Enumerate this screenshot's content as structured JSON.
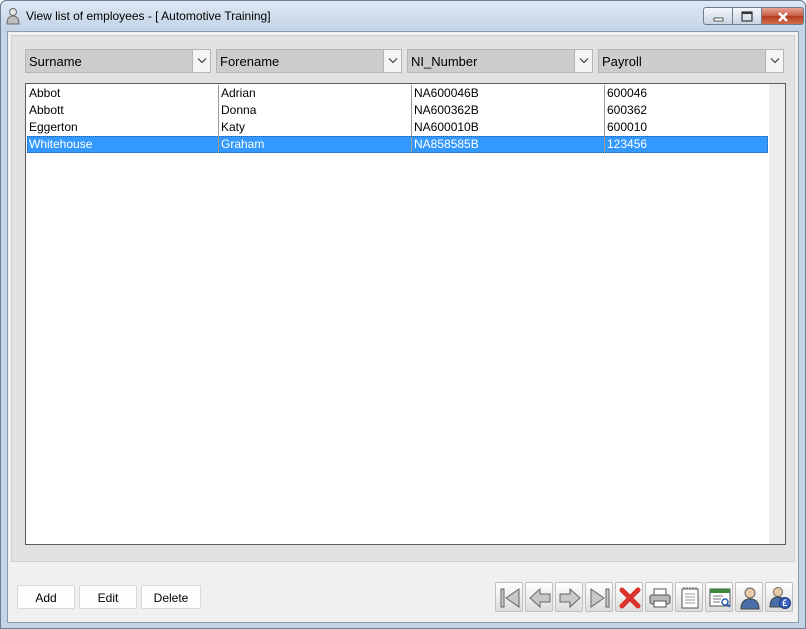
{
  "window": {
    "title": "View list of employees - [ Automotive Training]"
  },
  "grid": {
    "columns": [
      "Surname",
      "Forename",
      "NI_Number",
      "Payroll"
    ],
    "rows": [
      [
        "Abbot",
        "Adrian",
        "NA600046B",
        "600046"
      ],
      [
        "Abbott",
        "Donna",
        "NA600362B",
        "600362"
      ],
      [
        "Eggerton",
        "Katy",
        "NA600010B",
        "600010"
      ],
      [
        "Whitehouse",
        "Graham",
        "NA858585B",
        "123456"
      ]
    ],
    "selected_row": 3
  },
  "actions": {
    "add": "Add",
    "edit": "Edit",
    "delete": "Delete"
  },
  "toolbar_icons": [
    "first-record-icon",
    "previous-record-icon",
    "next-record-icon",
    "last-record-icon",
    "delete-record-icon",
    "print-icon",
    "notes-icon",
    "report-icon",
    "employee-icon",
    "employee-pay-icon"
  ],
  "colors": {
    "selection": "#3399ff",
    "delete_icon": "#d9342b"
  }
}
